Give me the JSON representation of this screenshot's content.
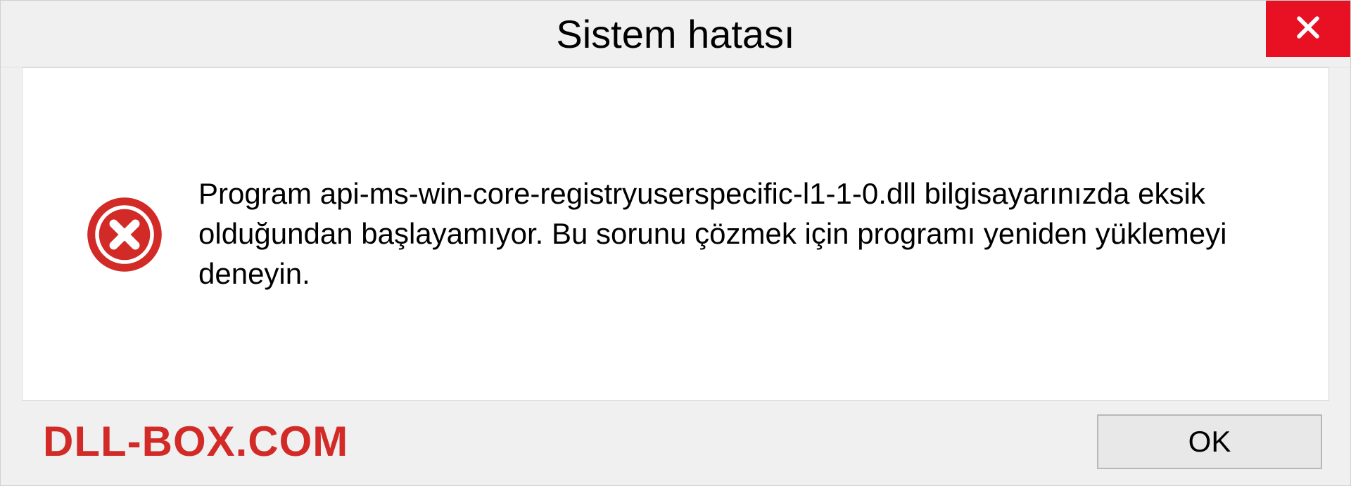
{
  "dialog": {
    "title": "Sistem hatası",
    "message": "Program api-ms-win-core-registryuserspecific-l1-1-0.dll bilgisayarınızda eksik olduğundan başlayamıyor. Bu sorunu çözmek için programı yeniden yüklemeyi deneyin.",
    "ok_label": "OK"
  },
  "brand": "DLL-BOX.COM",
  "colors": {
    "close_bg": "#e81123",
    "brand": "#d22b27",
    "error_icon": "#d22b27"
  },
  "icons": {
    "close": "close-icon",
    "error": "error-circle-icon"
  }
}
